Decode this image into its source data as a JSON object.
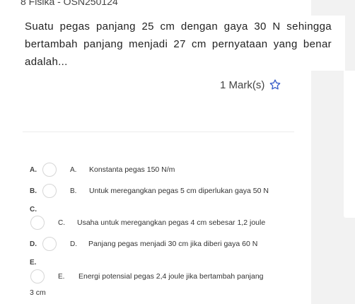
{
  "header": {
    "title": "8 Fisika - OSN250124"
  },
  "question": {
    "text": "Suatu pegas panjang 25 cm dengan gaya 30 N sehingga bertambah panjang menjadi 27 cm pernyataan yang benar adalah...",
    "marks": "1 Mark(s)",
    "favorite_icon": "star-outline-icon"
  },
  "options": [
    {
      "letter": "A.",
      "prefix": "A.",
      "text": "Konstanta pegas 150 N/m"
    },
    {
      "letter": "B.",
      "prefix": "B.",
      "text": "Untuk meregangkan pegas 5 cm diperlukan gaya 50 N"
    },
    {
      "letter": "C.",
      "prefix": "C.",
      "text": "Usaha untuk meregangkan pegas 4 cm sebesar 1,2 joule"
    },
    {
      "letter": "D.",
      "prefix": "D.",
      "text": "Panjang pegas menjadi 30 cm jika diberi gaya 60 N"
    },
    {
      "letter": "E.",
      "prefix": "E.",
      "text": "Energi potensial pegas 2,4 joule jika bertambah panjang",
      "text_cont": "3 cm"
    }
  ]
}
